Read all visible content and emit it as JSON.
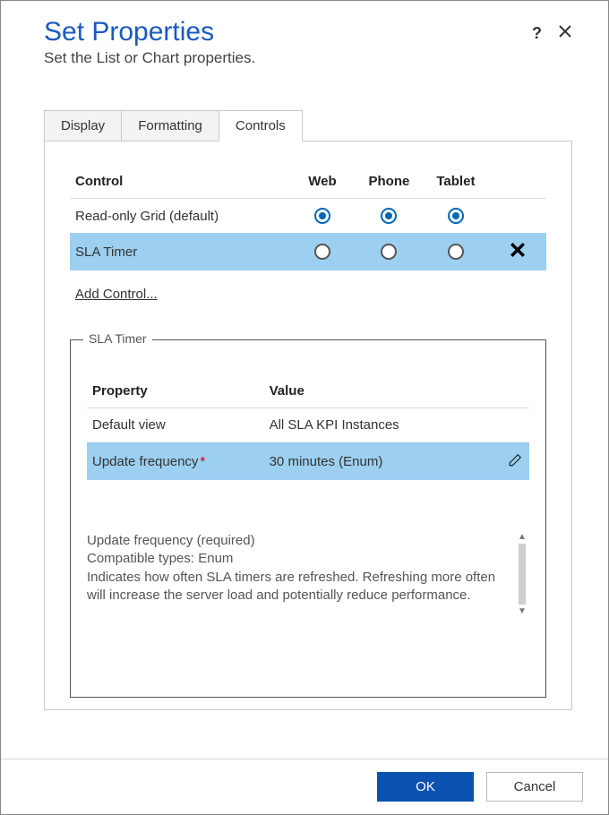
{
  "header": {
    "title": "Set Properties",
    "subtitle": "Set the List or Chart properties."
  },
  "tabs": [
    "Display",
    "Formatting",
    "Controls"
  ],
  "activeTabIndex": 2,
  "controlsTable": {
    "headers": {
      "control": "Control",
      "web": "Web",
      "phone": "Phone",
      "tablet": "Tablet"
    },
    "rows": [
      {
        "name": "Read-only Grid (default)",
        "web": true,
        "phone": true,
        "tablet": true,
        "selected": false,
        "removable": false
      },
      {
        "name": "SLA Timer",
        "web": false,
        "phone": false,
        "tablet": false,
        "selected": true,
        "removable": true
      }
    ],
    "addControlLabel": "Add Control..."
  },
  "propertiesPanel": {
    "legend": "SLA Timer",
    "headers": {
      "property": "Property",
      "value": "Value"
    },
    "rows": [
      {
        "property": "Default view",
        "required": false,
        "value": "All SLA KPI Instances",
        "selected": false,
        "editable": false
      },
      {
        "property": "Update frequency",
        "required": true,
        "value": "30 minutes (Enum)",
        "selected": true,
        "editable": true
      }
    ],
    "description": {
      "line1": "Update frequency (required)",
      "line2": "Compatible types: Enum",
      "line3": "Indicates how often SLA timers are refreshed. Refreshing more often will increase the server load and potentially reduce performance."
    }
  },
  "footer": {
    "ok": "OK",
    "cancel": "Cancel"
  }
}
